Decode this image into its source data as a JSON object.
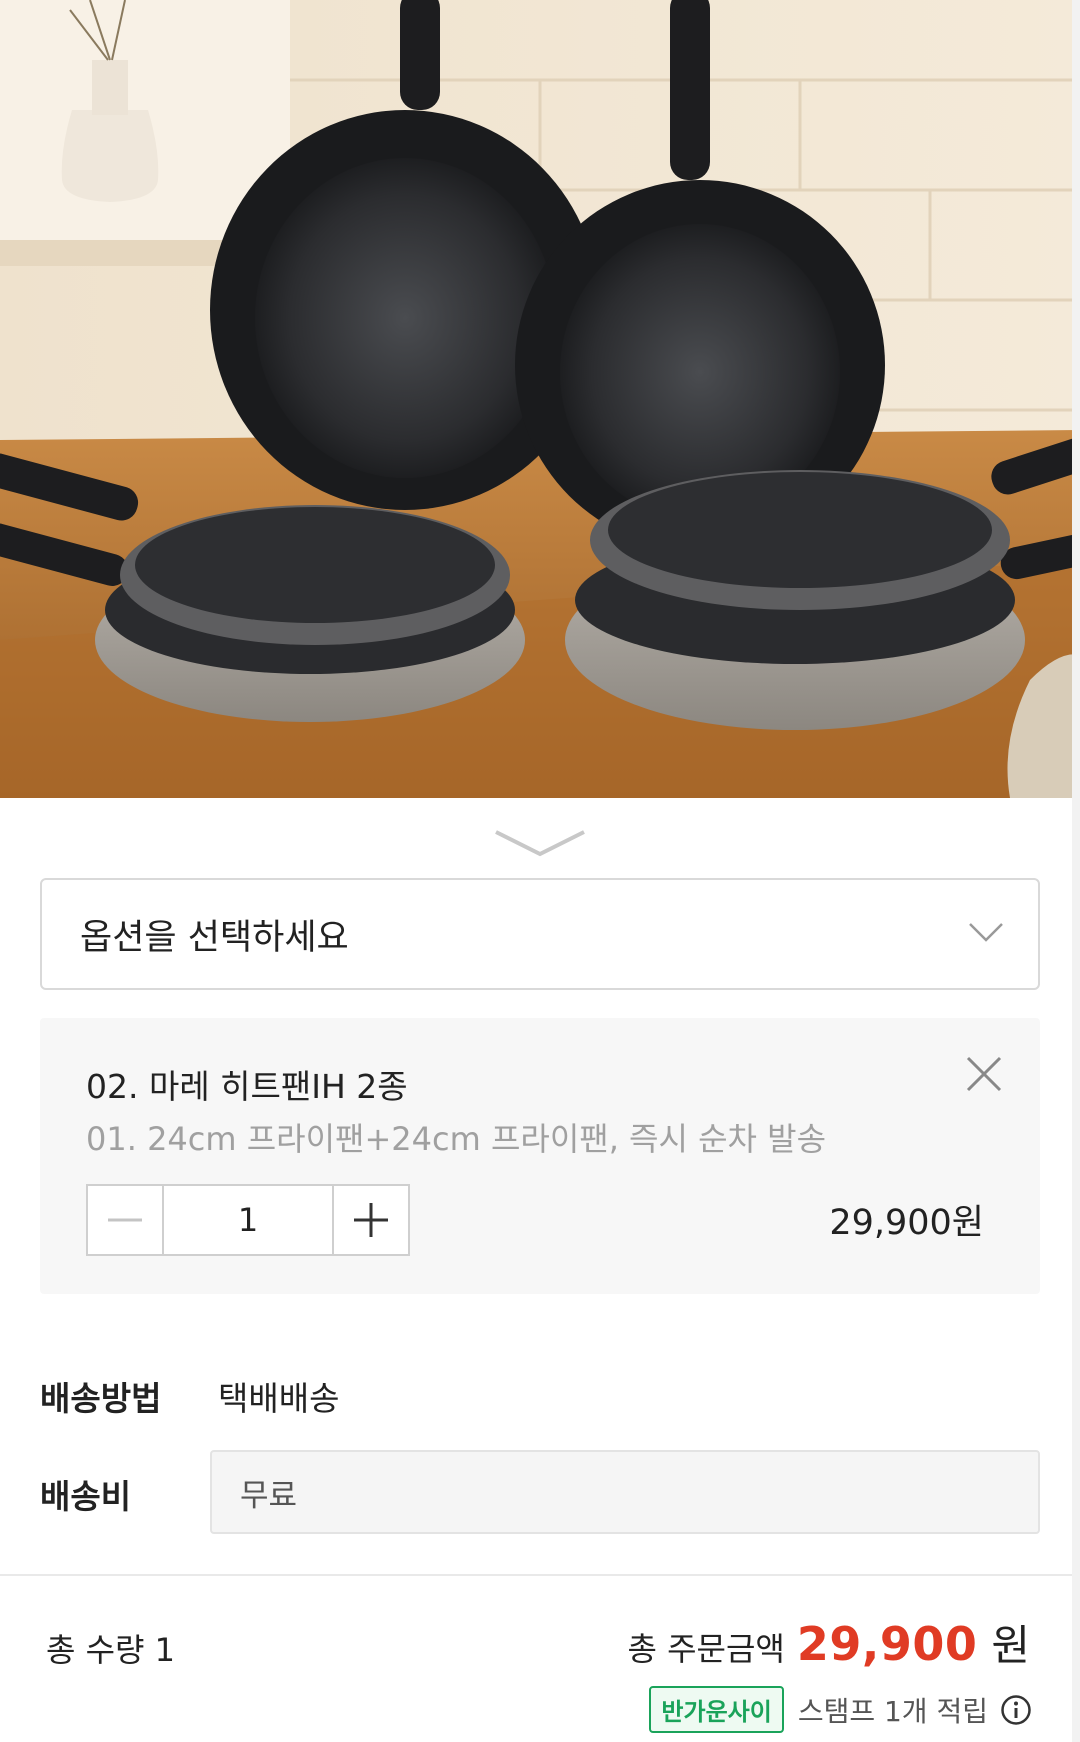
{
  "product_image": {
    "alt": "pan-set-photo"
  },
  "option_select": {
    "placeholder": "옵션을 선택하세요"
  },
  "selected_item": {
    "title": "02. 마레 히트팬IH 2종",
    "subtitle": "01. 24cm 프라이팬+24cm 프라이팬, 즉시 순차 발송",
    "quantity": "1",
    "price": "29,900원"
  },
  "shipping": {
    "method_label": "배송방법",
    "method_value": "택배배송",
    "fee_label": "배송비",
    "fee_value": "무료"
  },
  "totals": {
    "quantity_text": "총 수량 1",
    "amount_label": "총 주문금액",
    "amount_value": "29,900",
    "amount_unit": "원"
  },
  "stamp": {
    "badge": "반가운사이",
    "text": "스탬프 1개 적립"
  },
  "colors": {
    "accent_price": "#e03b24",
    "stamp_green": "#1aa35a"
  },
  "icons": [
    "chevron-down-icon",
    "close-icon",
    "minus-icon",
    "plus-icon",
    "info-icon"
  ]
}
